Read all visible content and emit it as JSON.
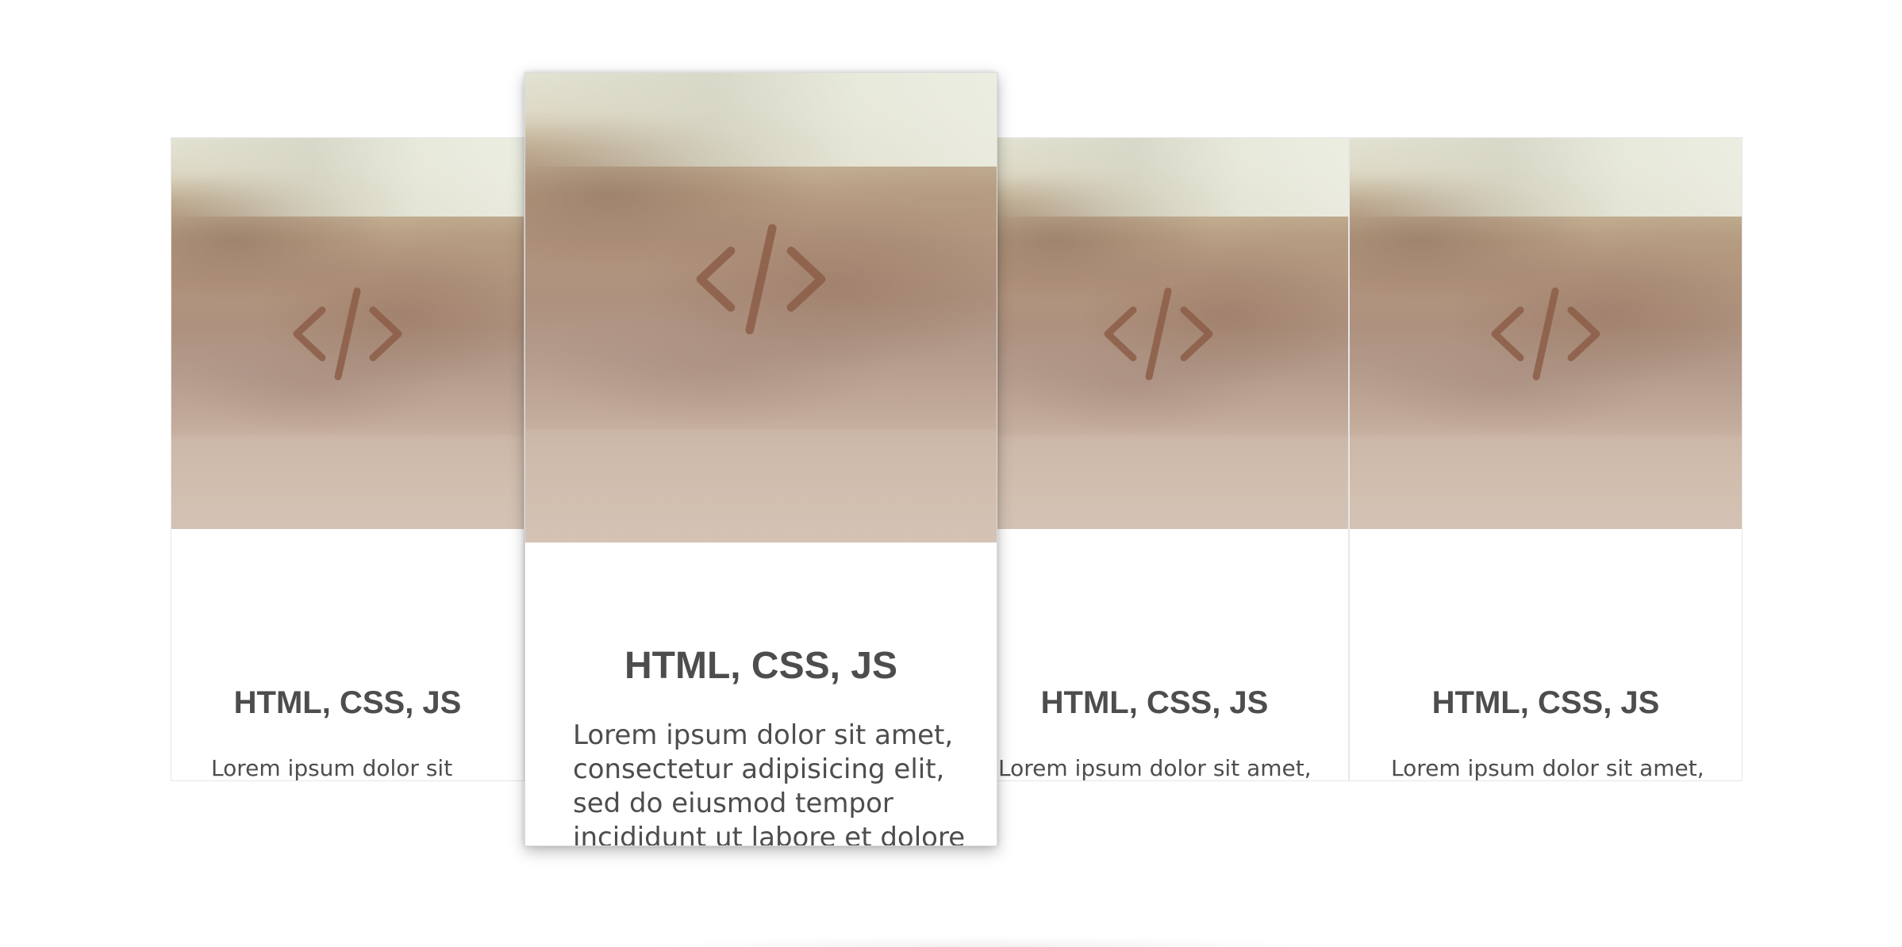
{
  "cards": [
    {
      "title": "HTML, CSS, JS",
      "text": "Lorem ipsum dolor sit amet, consectetur adipisicing elit, sed do eiusmod tempor incididunt ut labore et dolore magna aliqua. Ut",
      "icon": "code-icon"
    },
    {
      "title": "HTML, CSS, JS",
      "text": "Lorem ipsum dolor sit amet, consectetur adipisicing elit, sed do eiusmod tempor incididunt ut labore et dolore magna aliqua. Ut",
      "icon": "code-icon"
    },
    {
      "title": "HTML, CSS, JS",
      "text": "Lorem ipsum dolor sit amet, consectetur adipisicing elit, sed do eiusmod tempor incididunt ut labore et dolore magna aliqua. Ut",
      "icon": "code-icon"
    },
    {
      "title": "HTML, CSS, JS",
      "text": "Lorem ipsum dolor sit amet, consectetur adipisicing elit, sed do eiusmod tempor incididunt ut labore et dolore magna aliqua. Ut",
      "icon": "code-icon"
    }
  ],
  "colors": {
    "text": "#4d4d4d",
    "icon": "#8a5a44",
    "background": "#ffffff"
  }
}
